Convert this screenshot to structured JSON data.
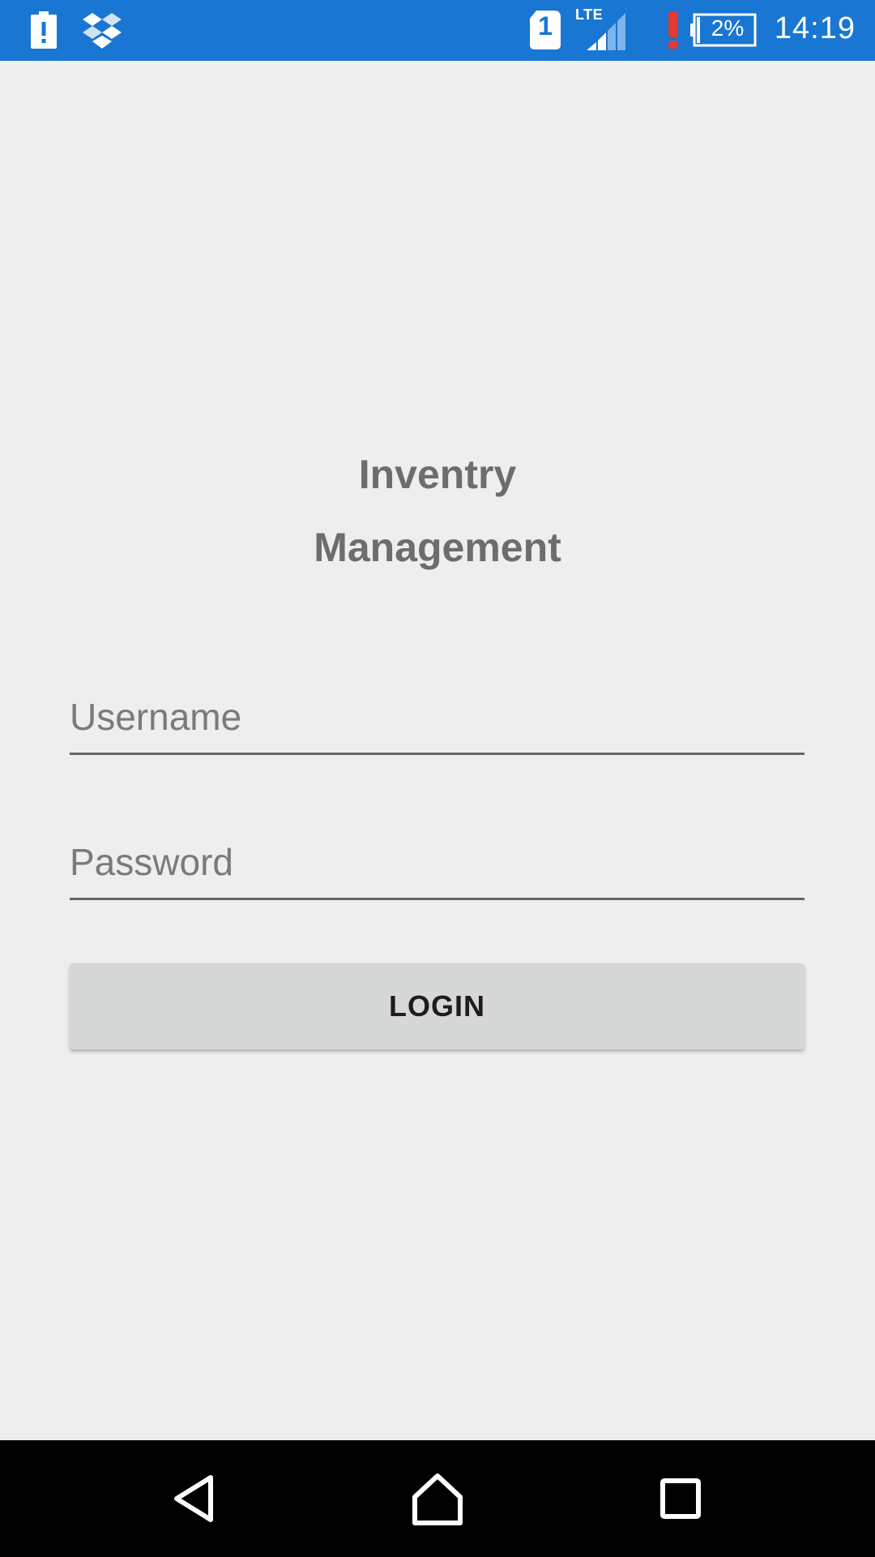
{
  "status_bar": {
    "icons": [
      "battery-alert-icon",
      "dropbox-icon",
      "sim-1-icon",
      "signal-icon",
      "warning-icon",
      "battery-icon"
    ],
    "network_type": "LTE",
    "sim_slot": "1",
    "battery_level": "2%",
    "time": "14:19",
    "colors": {
      "background": "#1976d2",
      "warning": "#e53935"
    }
  },
  "app": {
    "title_line1": "Inventry",
    "title_line2": "Management"
  },
  "form": {
    "username": {
      "value": "",
      "placeholder": "Username"
    },
    "password": {
      "value": "",
      "placeholder": "Password"
    },
    "login_label": "LOGIN"
  },
  "nav_bar": {
    "icons": [
      "back-icon",
      "home-icon",
      "recents-icon"
    ]
  },
  "colors": {
    "page_background": "#eeeeee",
    "title_text": "#6d6d6d",
    "button_background": "#d6d7d7"
  }
}
